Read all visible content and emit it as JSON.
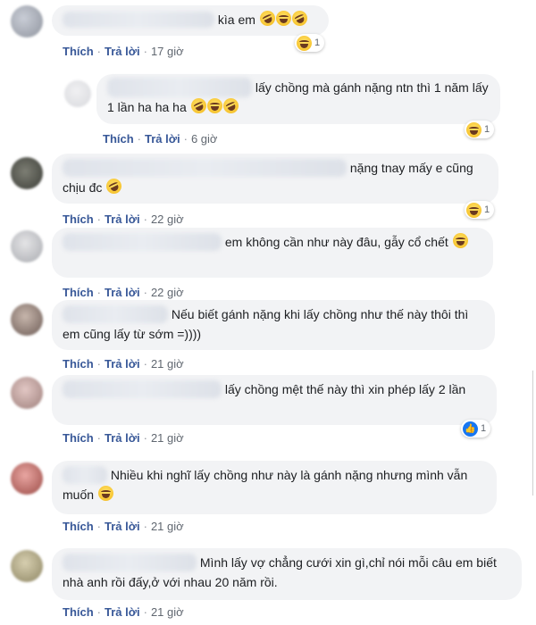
{
  "actions": {
    "like": "Thích",
    "reply": "Trả lời"
  },
  "comments": [
    {
      "text": "kìa em",
      "time": "17 giờ",
      "reaction_count": "1"
    },
    {
      "text": "lấy chồng mà gánh nặng ntn thì 1 năm lấy 1 lần ha ha ha",
      "time": "6 giờ",
      "reaction_count": "1"
    },
    {
      "text": "nặng tnay mấy e cũng chịu đc",
      "time": "22 giờ",
      "reaction_count": "1"
    },
    {
      "text": "em không cần như này đâu, gẫy cổ chết",
      "time": "22 giờ"
    },
    {
      "text": "Nếu biết gánh nặng khi lấy chồng như thế này thôi thì em cũng lấy từ sớm =))))",
      "time": "21 giờ"
    },
    {
      "text": "lấy chồng mệt thế này thì xin phép lấy 2 lần",
      "time": "21 giờ",
      "reaction_count": "1"
    },
    {
      "text": "Nhiều khi nghĩ lấy chồng như này là gánh nặng nhưng mình vẫn muốn",
      "time": "21 giờ"
    },
    {
      "text": "Mình lấy vợ chẳng cưới xin gì,chỉ nói mỗi câu em biết nhà anh rồi đấy,ở với nhau 20 năm rồi.",
      "time": "21 giờ"
    }
  ],
  "colors": {
    "bubble": "#f2f3f5",
    "link": "#385898",
    "like_blue": "#1877f2"
  },
  "icons": {
    "haha": "laughing-emoji-icon",
    "like": "thumbs-up-icon"
  }
}
